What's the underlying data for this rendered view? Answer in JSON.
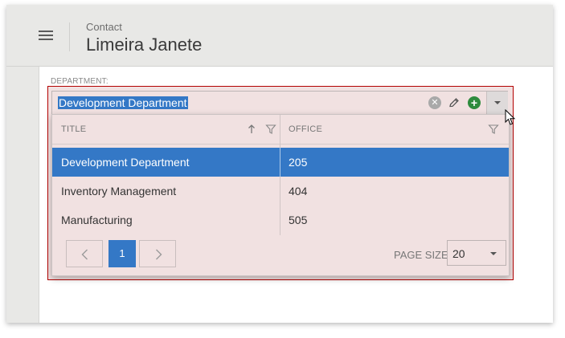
{
  "header": {
    "subtitle": "Contact",
    "title": "Limeira Janete"
  },
  "form": {
    "department_label": "DEPARTMENT:",
    "department_value": "Development Department"
  },
  "grid": {
    "columns": [
      {
        "label": "TITLE"
      },
      {
        "label": "OFFICE"
      }
    ],
    "rows": [
      {
        "title": "Development Department",
        "office": "205",
        "selected": true
      },
      {
        "title": "Inventory Management",
        "office": "404",
        "selected": false
      },
      {
        "title": "Manufacturing",
        "office": "505",
        "selected": false
      }
    ]
  },
  "pager": {
    "current_page": "1",
    "page_size_label": "PAGE SIZE",
    "page_size_value": "20"
  },
  "colors": {
    "accent": "#3478c6",
    "invalid_border": "#b30000",
    "editor_background": "#f1e1e1",
    "add_button": "#2e8b3d"
  },
  "icons": [
    "menu-icon",
    "clear-icon",
    "edit-icon",
    "add-icon",
    "dropdown-arrow-icon",
    "sort-ascending-icon",
    "filter-icon",
    "chevron-left-icon",
    "chevron-right-icon",
    "mouse-cursor-icon"
  ]
}
